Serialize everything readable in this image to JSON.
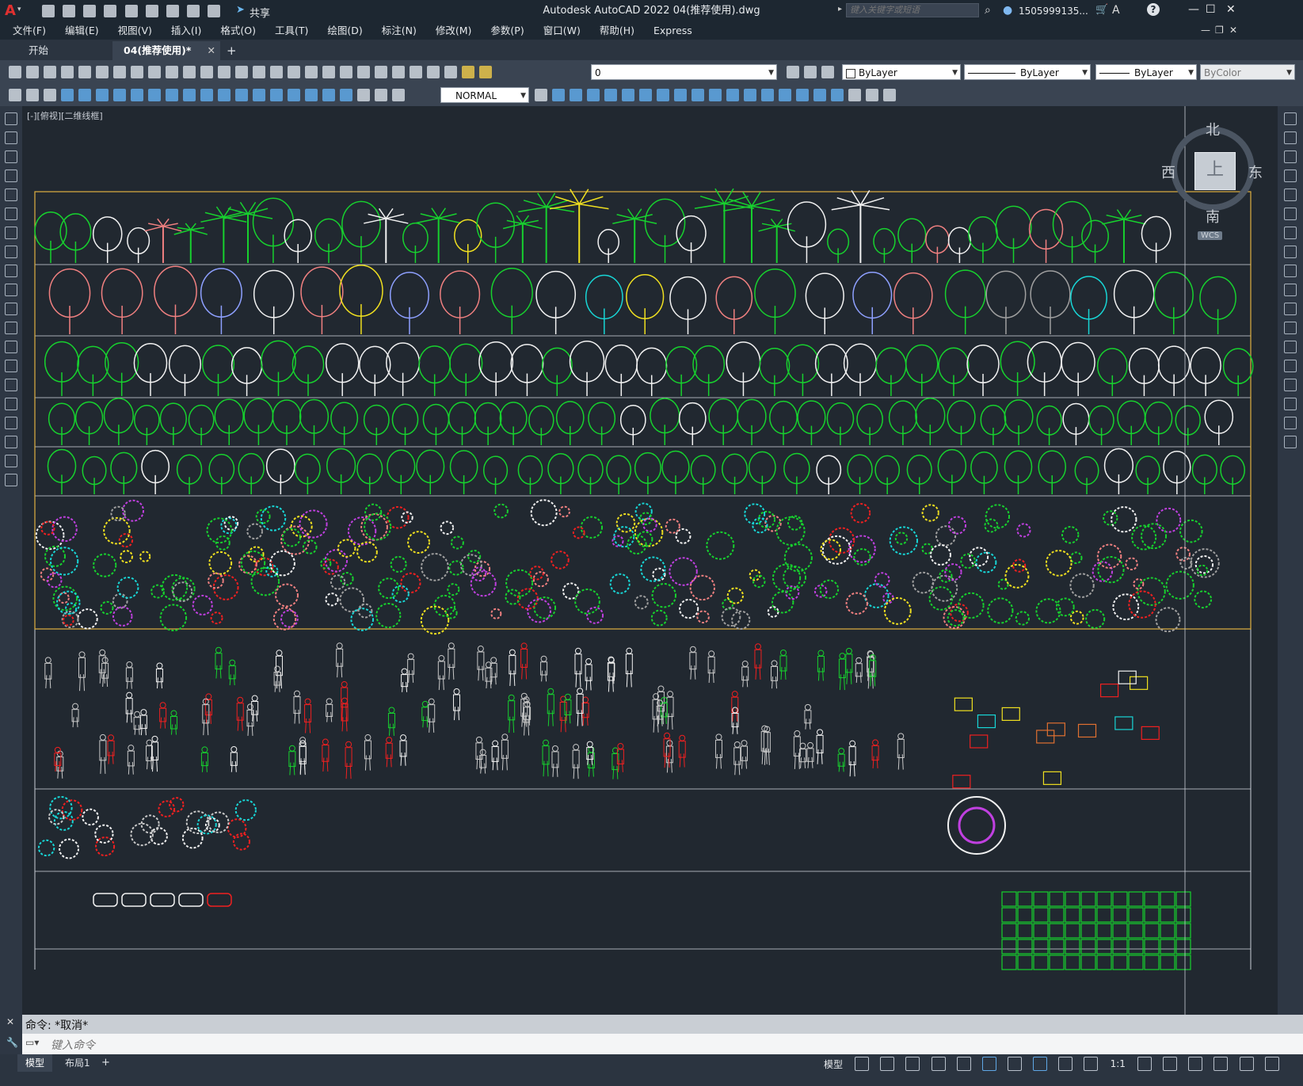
{
  "titlebar": {
    "app_letter": "A",
    "share_label": "共享",
    "title": "Autodesk AutoCAD 2022    04(推荐使用).dwg",
    "search_placeholder": "键入关键字或短语",
    "user": "1505999135...",
    "help": "?"
  },
  "menubar": {
    "items": [
      "文件(F)",
      "编辑(E)",
      "视图(V)",
      "插入(I)",
      "格式(O)",
      "工具(T)",
      "绘图(D)",
      "标注(N)",
      "修改(M)",
      "参数(P)",
      "窗口(W)",
      "帮助(H)",
      "Express"
    ]
  },
  "tabs": {
    "start": "开始",
    "active": "04(推荐使用)*",
    "close": "✕",
    "add": "+"
  },
  "toolbar": {
    "layer_value": "0",
    "color_value": "ByLayer",
    "linetype_value": "ByLayer",
    "lineweight_value": "ByLayer",
    "plotstyle_value": "ByColor",
    "style_value": "NORMAL"
  },
  "viewport": {
    "label": "[-][俯视][二维线框]"
  },
  "viewcube": {
    "north": "北",
    "south": "南",
    "east": "东",
    "west": "西",
    "top": "上",
    "wcs": "WCS"
  },
  "command": {
    "history": "命令: *取消*",
    "placeholder": "键入命令"
  },
  "layout_tabs": {
    "model": "模型",
    "layout1": "布局1",
    "add": "+"
  },
  "status": {
    "model": "模型",
    "scale": "1:1"
  },
  "colors": {
    "canvas": "#212830",
    "frame": "#e0b040",
    "row_line": "#c9ced6",
    "green": "#17d12e",
    "white": "#f2f2f2",
    "pink": "#f08080",
    "yellow": "#f0e020",
    "cyan": "#18d6d6",
    "red": "#f02020",
    "magenta": "#c040e0"
  }
}
